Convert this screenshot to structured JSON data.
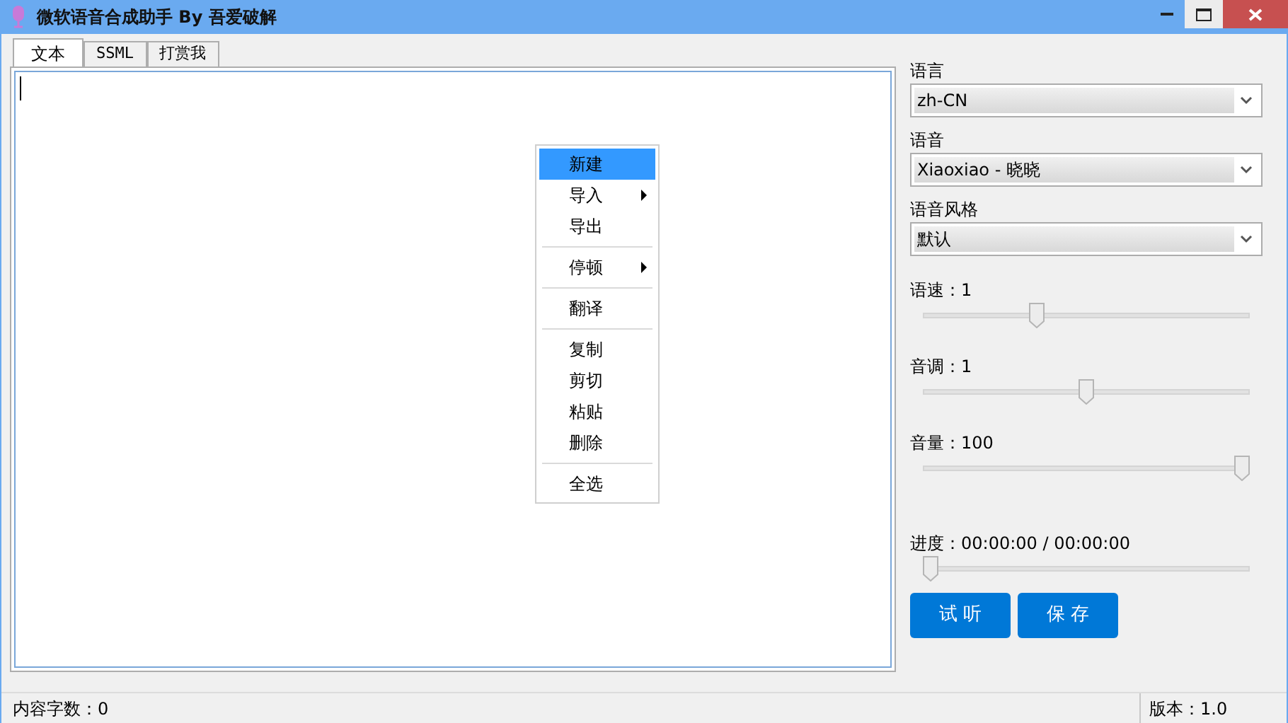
{
  "window": {
    "title": "微软语音合成助手 By 吾爱破解"
  },
  "tabs": [
    {
      "label": "文本",
      "selected": true
    },
    {
      "label": "SSML",
      "selected": false
    },
    {
      "label": "打赏我",
      "selected": false
    }
  ],
  "context_menu": [
    {
      "kind": "item",
      "label": "新建",
      "selected": true,
      "submenu": false
    },
    {
      "kind": "item",
      "label": "导入",
      "selected": false,
      "submenu": true
    },
    {
      "kind": "item",
      "label": "导出",
      "selected": false,
      "submenu": false
    },
    {
      "kind": "separator"
    },
    {
      "kind": "item",
      "label": "停顿",
      "selected": false,
      "submenu": true
    },
    {
      "kind": "separator"
    },
    {
      "kind": "item",
      "label": "翻译",
      "selected": false,
      "submenu": false
    },
    {
      "kind": "separator"
    },
    {
      "kind": "item",
      "label": "复制",
      "selected": false,
      "submenu": false
    },
    {
      "kind": "item",
      "label": "剪切",
      "selected": false,
      "submenu": false
    },
    {
      "kind": "item",
      "label": "粘贴",
      "selected": false,
      "submenu": false
    },
    {
      "kind": "item",
      "label": "删除",
      "selected": false,
      "submenu": false
    },
    {
      "kind": "separator"
    },
    {
      "kind": "item",
      "label": "全选",
      "selected": false,
      "submenu": false
    }
  ],
  "selects": [
    {
      "label": "语言",
      "value": "zh-CN"
    },
    {
      "label": "语音",
      "value": "Xiaoxiao - 晓晓"
    },
    {
      "label": "语音风格",
      "value": "默认"
    }
  ],
  "sliders": [
    {
      "label": "语速：1",
      "level": 0.34
    },
    {
      "label": "音调：1",
      "level": 0.5
    },
    {
      "label": "音量：100",
      "level": 1
    }
  ],
  "progress": {
    "label": "进度：00:00:00 / 00:00:00",
    "level": 0
  },
  "buttons": [
    "试 听",
    "保 存"
  ],
  "status_bar": {
    "left": "内容字数：0",
    "right": "版本：1.0"
  }
}
